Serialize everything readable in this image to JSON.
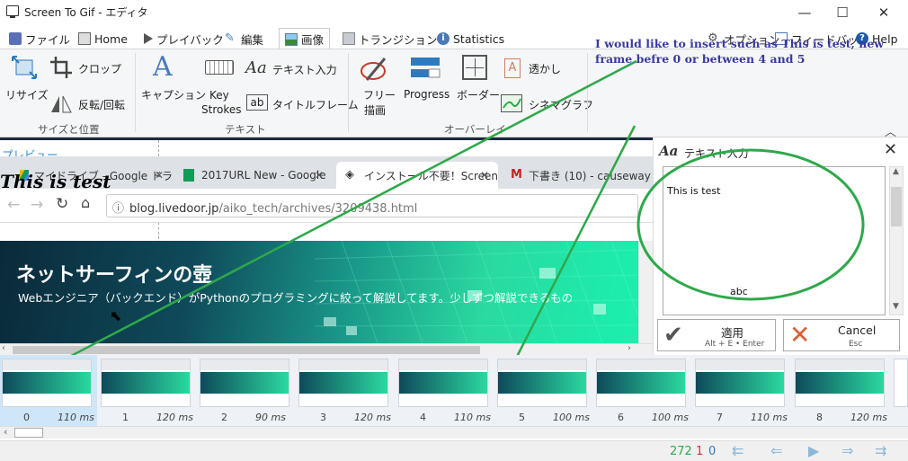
{
  "window": {
    "title": "Screen To Gif - エディタ",
    "minimize": "—",
    "maximize": "☐",
    "close": "✕"
  },
  "tabs": [
    {
      "label": "ファイル"
    },
    {
      "label": "Home"
    },
    {
      "label": "プレイバック"
    },
    {
      "label": "編集"
    },
    {
      "label": "画像",
      "active": true
    },
    {
      "label": "トランジション"
    },
    {
      "label": "Statistics"
    }
  ],
  "topright": {
    "options": "オプション",
    "feedback": "フィードバック",
    "help": "Help"
  },
  "ribbon": {
    "resize": "リサイズ",
    "crop": "クロップ",
    "flip": "反転/回転",
    "group_size": "サイズと位置",
    "caption": "キャプション",
    "key_strokes_1": "Key",
    "key_strokes_2": "Strokes",
    "text_input": "テキスト入力",
    "title_frame": "タイトルフレーム",
    "group_text": "テキスト",
    "free_draw_1": "フリー",
    "free_draw_2": "描画",
    "progress": "Progress",
    "border": "ボーダー",
    "watermark": "透かし",
    "cinemagraph": "シネマグラフ",
    "group_overlay": "オーバーレイ"
  },
  "note": "I would like to insert  such as This is test, new frame befre 0 or between 4 and 5",
  "preview": {
    "label": "プレビュー",
    "caption_text": "This is test",
    "browser_tabs": [
      "マイドライブ - Google ドラ",
      "2017URL New - Google",
      "インストール不要！Screen",
      "下書き (10) - causeway"
    ],
    "url_prefix": "blog.livedoor.jp",
    "url_rest": "/aiko_tech/archives/3209438.html",
    "site_title": "ネットサーフィンの壺",
    "site_desc": "Webエンジニア（バックエンド）がPythonのプログラミングに絞って解説してます。少しずつ解説できるもの"
  },
  "text_panel": {
    "header": "テキスト入力",
    "content": "This is test",
    "abc": "abc",
    "apply": "適用",
    "apply_shortcut": "Alt + E • Enter",
    "cancel": "Cancel",
    "cancel_shortcut": "Esc"
  },
  "frames": [
    {
      "num": "0",
      "ms": "110 ms"
    },
    {
      "num": "1",
      "ms": "120 ms"
    },
    {
      "num": "2",
      "ms": "90 ms"
    },
    {
      "num": "3",
      "ms": "120 ms"
    },
    {
      "num": "4",
      "ms": "110 ms"
    },
    {
      "num": "5",
      "ms": "100 ms"
    },
    {
      "num": "6",
      "ms": "100 ms"
    },
    {
      "num": "7",
      "ms": "110 ms"
    },
    {
      "num": "8",
      "ms": "120 ms"
    }
  ],
  "status": {
    "total": "272",
    "selected": "1",
    "current": "0"
  },
  "colors": {
    "accent": "#2d8fd6",
    "annotation_green": "#2ea84a",
    "note_blue": "#3a3aa0"
  }
}
